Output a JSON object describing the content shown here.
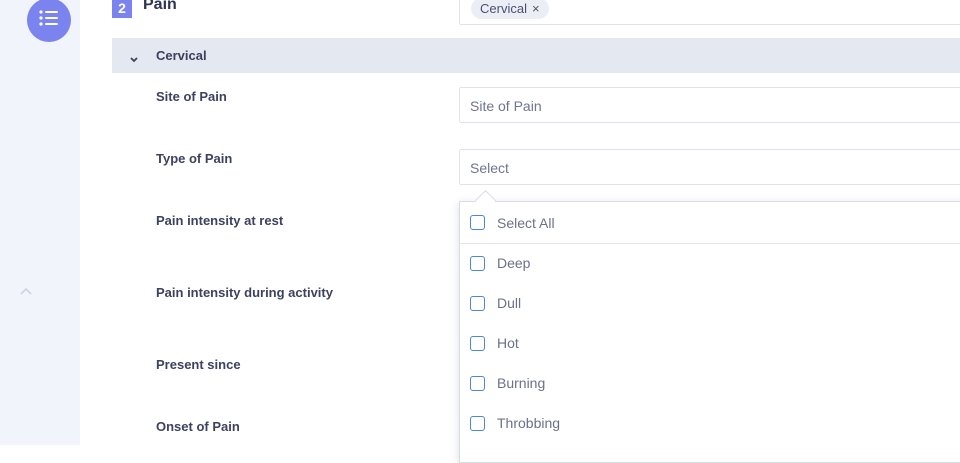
{
  "section": {
    "number": "2",
    "title": "Pain"
  },
  "pain_region": {
    "chips": [
      "Cervical"
    ],
    "remove_glyph": "×"
  },
  "group": {
    "title": "Cervical"
  },
  "fields": {
    "site_of_pain": {
      "label": "Site of Pain",
      "placeholder": "Site of Pain"
    },
    "type_of_pain": {
      "label": "Type of Pain",
      "placeholder": "Select"
    },
    "intensity_rest": {
      "label": "Pain intensity at rest"
    },
    "intensity_activity": {
      "label": "Pain intensity during activity"
    },
    "present_since": {
      "label": "Present since"
    },
    "onset": {
      "label": "Onset of Pain"
    }
  },
  "type_dropdown": {
    "select_all": "Select All",
    "options": [
      "Deep",
      "Dull",
      "Hot",
      "Burning",
      "Throbbing"
    ]
  },
  "icons": {
    "menu": "list-icon",
    "collapse": "chevron-up-icon",
    "group_toggle": "chevron-down-icon"
  },
  "colors": {
    "accent": "#7b83ee",
    "sidebar_bg": "#f2f4fb",
    "group_header_bg": "#e4e8f0",
    "checkbox_border": "#4c86d8"
  }
}
